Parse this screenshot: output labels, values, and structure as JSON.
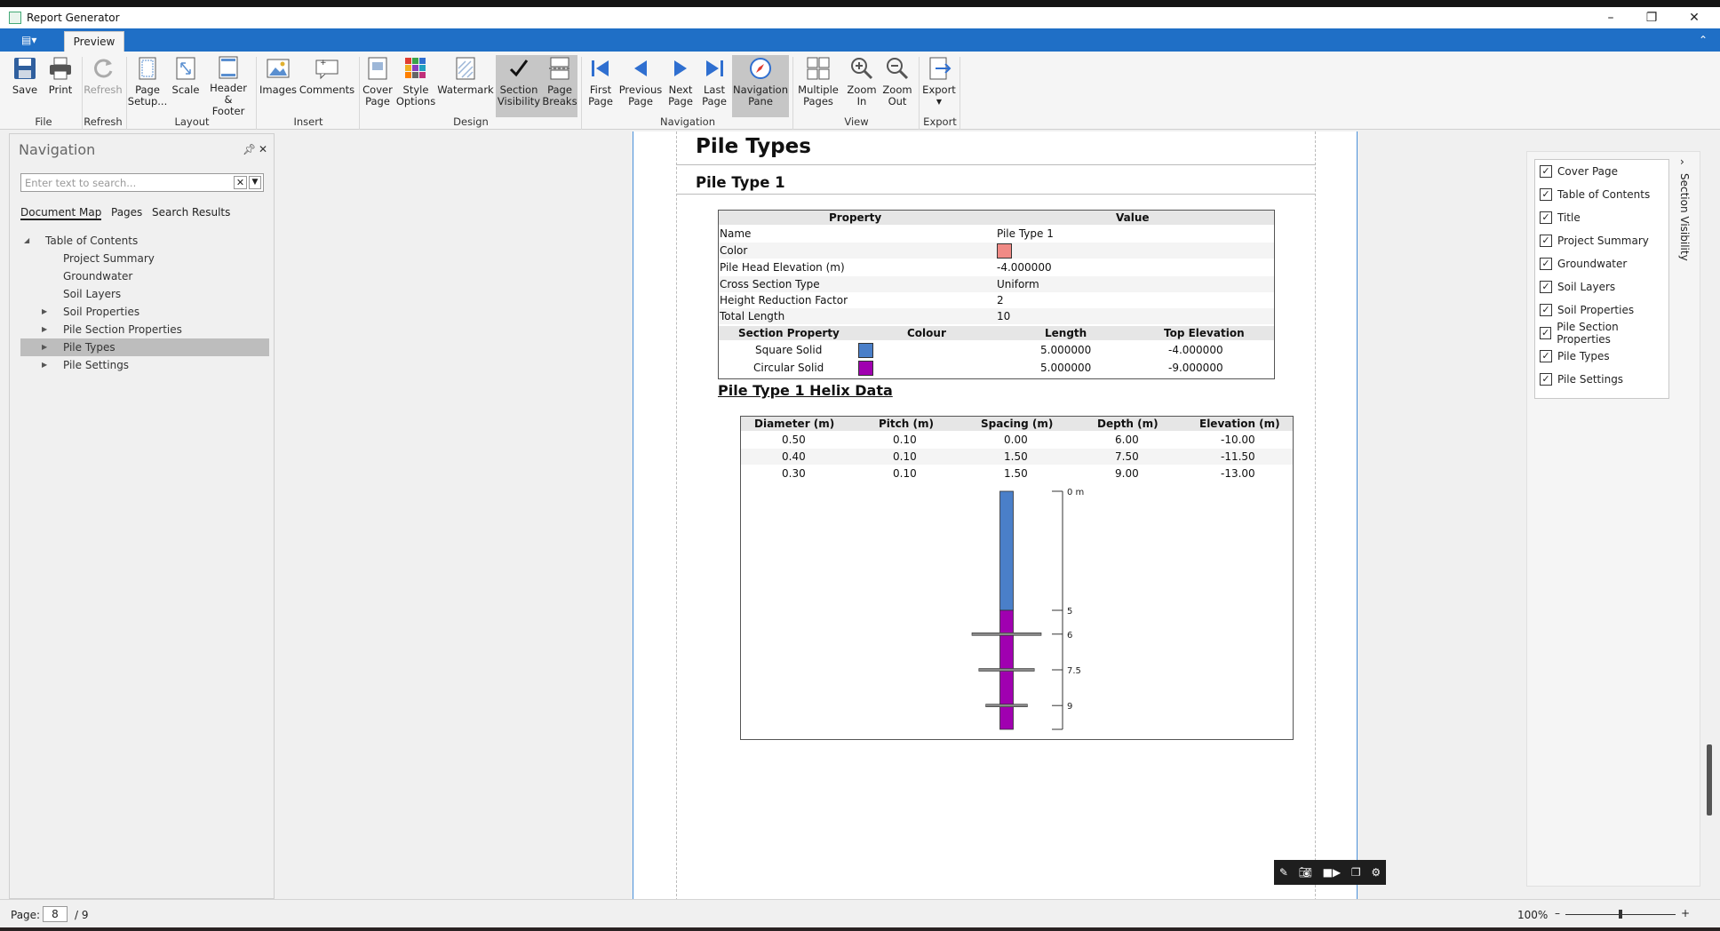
{
  "window": {
    "title": "Report Generator"
  },
  "ribbon": {
    "tab_preview": "Preview",
    "buttons": {
      "save": "Save",
      "print": "Print",
      "refresh": "Refresh",
      "page_setup_1": "Page",
      "page_setup_2": "Setup...",
      "scale": "Scale",
      "header_footer_1": "Header &",
      "header_footer_2": "Footer",
      "images": "Images",
      "comments": "Comments",
      "cover_page_1": "Cover",
      "cover_page_2": "Page",
      "style_options_1": "Style",
      "style_options_2": "Options",
      "watermark": "Watermark",
      "section_visibility_1": "Section",
      "section_visibility_2": "Visibility",
      "page_breaks_1": "Page",
      "page_breaks_2": "Breaks",
      "first_page_1": "First",
      "first_page_2": "Page",
      "previous_page_1": "Previous",
      "previous_page_2": "Page",
      "next_page_1": "Next",
      "next_page_2": "Page",
      "last_page_1": "Last",
      "last_page_2": "Page",
      "navigation_pane_1": "Navigation",
      "navigation_pane_2": "Pane",
      "multiple_pages_1": "Multiple",
      "multiple_pages_2": "Pages",
      "zoom_in_1": "Zoom",
      "zoom_in_2": "In",
      "zoom_out_1": "Zoom",
      "zoom_out_2": "Out",
      "export": "Export"
    },
    "groups": {
      "file": "File",
      "refresh": "Refresh",
      "layout": "Layout",
      "insert": "Insert",
      "design": "Design",
      "navigation": "Navigation",
      "view": "View",
      "export": "Export"
    }
  },
  "nav": {
    "title": "Navigation",
    "search_placeholder": "Enter text to search...",
    "tabs": {
      "document_map": "Document Map",
      "pages": "Pages",
      "search_results": "Search Results"
    },
    "tree": {
      "root": "Table of Contents",
      "project_summary": "Project Summary",
      "groundwater": "Groundwater",
      "soil_layers": "Soil Layers",
      "soil_properties": "Soil Properties",
      "pile_section_properties": "Pile Section Properties",
      "pile_types": "Pile Types",
      "pile_settings": "Pile Settings"
    }
  },
  "report": {
    "heading": "Pile Types",
    "subheading": "Pile Type 1",
    "prop_table": {
      "h_property": "Property",
      "h_value": "Value",
      "rows": [
        {
          "k": "Name",
          "v": "Pile Type 1"
        },
        {
          "k": "Color",
          "v": ""
        },
        {
          "k": "Pile Head Elevation (m)",
          "v": "-4.000000"
        },
        {
          "k": "Cross Section Type",
          "v": "Uniform"
        },
        {
          "k": "Height Reduction Factor",
          "v": "2"
        },
        {
          "k": "Total Length",
          "v": "10"
        }
      ],
      "color_swatch": "#f08a85",
      "section_headers": {
        "prop": "Section Property",
        "colour": "Colour",
        "length": "Length",
        "top": "Top Elevation"
      },
      "sections": [
        {
          "name": "Square Solid",
          "color": "#4a7fc9",
          "length": "5.000000",
          "top": "-4.000000"
        },
        {
          "name": "Circular Solid",
          "color": "#a000b0",
          "length": "5.000000",
          "top": "-9.000000"
        }
      ]
    },
    "helix_title": "Pile Type 1 Helix Data",
    "helix_table": {
      "headers": {
        "diameter": "Diameter (m)",
        "pitch": "Pitch (m)",
        "spacing": "Spacing (m)",
        "depth": "Depth (m)",
        "elevation": "Elevation (m)"
      },
      "rows": [
        {
          "diameter": "0.50",
          "pitch": "0.10",
          "spacing": "0.00",
          "depth": "6.00",
          "elevation": "-10.00"
        },
        {
          "diameter": "0.40",
          "pitch": "0.10",
          "spacing": "1.50",
          "depth": "7.50",
          "elevation": "-11.50"
        },
        {
          "diameter": "0.30",
          "pitch": "0.10",
          "spacing": "1.50",
          "depth": "9.00",
          "elevation": "-13.00"
        }
      ]
    },
    "diagram": {
      "ticks": [
        {
          "depth": 0,
          "label": "0 m"
        },
        {
          "depth": 5,
          "label": "5"
        },
        {
          "depth": 6,
          "label": "6"
        },
        {
          "depth": 7.5,
          "label": "7.5"
        },
        {
          "depth": 9,
          "label": "9"
        }
      ],
      "total_depth": 10,
      "segments": [
        {
          "from": 0,
          "to": 5,
          "color": "#4a7fc9"
        },
        {
          "from": 5,
          "to": 10,
          "color": "#a000b0"
        }
      ],
      "helices": [
        {
          "depth": 6,
          "diameter": 0.5
        },
        {
          "depth": 7.5,
          "diameter": 0.4
        },
        {
          "depth": 9,
          "diameter": 0.3
        }
      ]
    }
  },
  "section_visibility": {
    "title": "Section Visibility",
    "items": [
      {
        "label": "Cover Page",
        "checked": true
      },
      {
        "label": "Table of Contents",
        "checked": true
      },
      {
        "label": "Title",
        "checked": true
      },
      {
        "label": "Project Summary",
        "checked": true
      },
      {
        "label": "Groundwater",
        "checked": true
      },
      {
        "label": "Soil Layers",
        "checked": true
      },
      {
        "label": "Soil Properties",
        "checked": true
      },
      {
        "label": "Pile Section Properties",
        "checked": true
      },
      {
        "label": "Pile Types",
        "checked": true
      },
      {
        "label": "Pile Settings",
        "checked": true
      }
    ]
  },
  "status": {
    "page_label": "Page:",
    "current_page": "8",
    "total_pages": "/ 9",
    "zoom": "100%",
    "zoom_fraction": 0.5
  }
}
